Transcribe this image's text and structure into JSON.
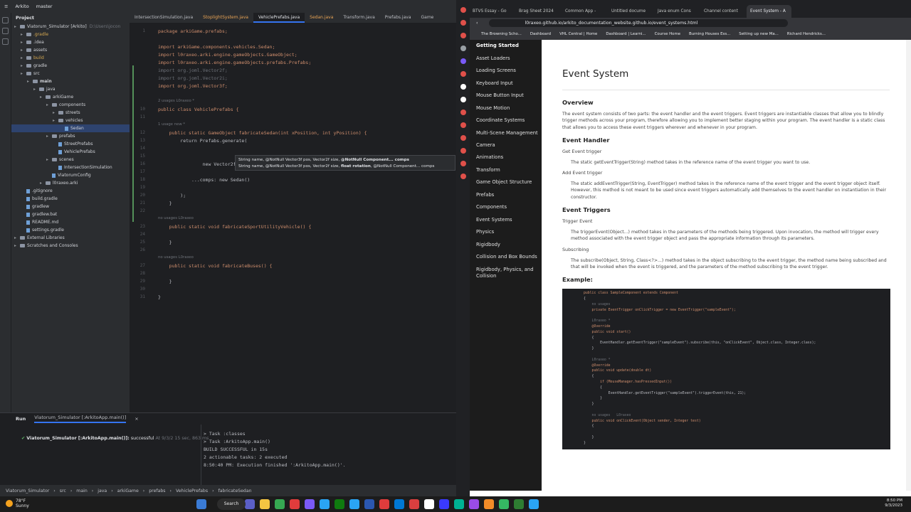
{
  "ide": {
    "menu_icon": "hamburger-icon",
    "project_name": "Arkito",
    "branch": "master",
    "panel_title": "Project",
    "tree": [
      {
        "label": "Viatorum_Simulator [Arkito]",
        "suffix": "D:\\Users\\jocon",
        "depth": 0,
        "kind": "folder",
        "state": ""
      },
      {
        "label": ".gradle",
        "suffix": "",
        "depth": 1,
        "kind": "folder",
        "state": "dim"
      },
      {
        "label": ".idea",
        "suffix": "",
        "depth": 1,
        "kind": "folder",
        "state": ""
      },
      {
        "label": "assets",
        "suffix": "",
        "depth": 1,
        "kind": "folder",
        "state": ""
      },
      {
        "label": "build",
        "suffix": "",
        "depth": 1,
        "kind": "folder",
        "state": "dim"
      },
      {
        "label": "gradle",
        "suffix": "",
        "depth": 1,
        "kind": "folder",
        "state": ""
      },
      {
        "label": "src",
        "suffix": "",
        "depth": 1,
        "kind": "folder",
        "state": ""
      },
      {
        "label": "main",
        "suffix": "",
        "depth": 2,
        "kind": "folder",
        "state": "bold"
      },
      {
        "label": "java",
        "suffix": "",
        "depth": 3,
        "kind": "folder",
        "state": ""
      },
      {
        "label": "arkiGame",
        "suffix": "",
        "depth": 4,
        "kind": "folder",
        "state": ""
      },
      {
        "label": "components",
        "suffix": "",
        "depth": 5,
        "kind": "folder",
        "state": ""
      },
      {
        "label": "streets",
        "suffix": "",
        "depth": 6,
        "kind": "folder",
        "state": ""
      },
      {
        "label": "vehicles",
        "suffix": "",
        "depth": 6,
        "kind": "folder",
        "state": ""
      },
      {
        "label": "Sedan",
        "suffix": "",
        "depth": 7,
        "kind": "file",
        "state": "sel"
      },
      {
        "label": "prefabs",
        "suffix": "",
        "depth": 5,
        "kind": "folder",
        "state": ""
      },
      {
        "label": "StreetPrefabs",
        "suffix": "",
        "depth": 6,
        "kind": "file",
        "state": ""
      },
      {
        "label": "VehiclePrefabs",
        "suffix": "",
        "depth": 6,
        "kind": "file",
        "state": ""
      },
      {
        "label": "scenes",
        "suffix": "",
        "depth": 5,
        "kind": "folder",
        "state": ""
      },
      {
        "label": "IntersectionSimulation",
        "suffix": "",
        "depth": 6,
        "kind": "file",
        "state": ""
      },
      {
        "label": "ViatorumConfig",
        "suffix": "",
        "depth": 5,
        "kind": "file",
        "state": ""
      },
      {
        "label": "l0raxeo.arki",
        "suffix": "",
        "depth": 4,
        "kind": "folder",
        "state": ""
      },
      {
        "label": ".gitignore",
        "suffix": "",
        "depth": 1,
        "kind": "file",
        "state": ""
      },
      {
        "label": "build.gradle",
        "suffix": "",
        "depth": 1,
        "kind": "file",
        "state": ""
      },
      {
        "label": "gradlew",
        "suffix": "",
        "depth": 1,
        "kind": "file",
        "state": ""
      },
      {
        "label": "gradlew.bat",
        "suffix": "",
        "depth": 1,
        "kind": "file",
        "state": ""
      },
      {
        "label": "README.md",
        "suffix": "",
        "depth": 1,
        "kind": "file",
        "state": ""
      },
      {
        "label": "settings.gradle",
        "suffix": "",
        "depth": 1,
        "kind": "file",
        "state": ""
      },
      {
        "label": "External Libraries",
        "suffix": "",
        "depth": 0,
        "kind": "folder",
        "state": ""
      },
      {
        "label": "Scratches and Consoles",
        "suffix": "",
        "depth": 0,
        "kind": "folder",
        "state": ""
      }
    ],
    "tabs": [
      {
        "label": "IntersectionSimulation.java",
        "state": ""
      },
      {
        "label": "StoplightSystem.java",
        "state": "orange"
      },
      {
        "label": "VehiclePrefabs.java",
        "state": "active"
      },
      {
        "label": "Sedan.java",
        "state": "orange"
      },
      {
        "label": "Transform.java",
        "state": ""
      },
      {
        "label": "Prefabs.java",
        "state": ""
      },
      {
        "label": "Game",
        "state": ""
      }
    ],
    "code": [
      {
        "n": "1",
        "t": "package arkiGame.prefabs;"
      },
      {
        "n": "",
        "t": ""
      },
      {
        "n": "",
        "t": "import arkiGame.components.vehicles.Sedan;"
      },
      {
        "n": "",
        "t": "import l0raxeo.arki.engine.gameObjects.GameObject;"
      },
      {
        "n": "",
        "t": "import l0raxeo.arki.engine.gameObjects.prefabs.Prefabs;"
      },
      {
        "n": "",
        "t": "import org.joml.Vector2f;"
      },
      {
        "n": "",
        "t": "import org.joml.Vector2i;"
      },
      {
        "n": "",
        "t": "import org.joml.Vector3f;"
      },
      {
        "n": "",
        "t": ""
      },
      {
        "n": "",
        "t": "2 usages   L0raxeo *"
      },
      {
        "n": "10",
        "t": "public class VehiclePrefabs {"
      },
      {
        "n": "11",
        "t": ""
      },
      {
        "n": "",
        "t": "    1 usage   new *"
      },
      {
        "n": "12",
        "t": "    public static GameObject fabricateSedan(int xPosition, int yPosition) {"
      },
      {
        "n": "13",
        "t": "        return Prefabs.generate("
      },
      {
        "n": "14",
        "t": ""
      },
      {
        "n": "15",
        "t": ""
      },
      {
        "n": "16",
        "t": "                new Vector2f( 0, 40);"
      },
      {
        "n": "17",
        "t": ""
      },
      {
        "n": "18",
        "t": "            ...comps: new Sedan()"
      },
      {
        "n": "19",
        "t": ""
      },
      {
        "n": "20",
        "t": "        );"
      },
      {
        "n": "21",
        "t": "    }"
      },
      {
        "n": "22",
        "t": ""
      },
      {
        "n": "",
        "t": "    no usages   L0raxeo"
      },
      {
        "n": "23",
        "t": "    public static void fabricateSportUtilityVehicle() {"
      },
      {
        "n": "24",
        "t": ""
      },
      {
        "n": "25",
        "t": "    }"
      },
      {
        "n": "26",
        "t": ""
      },
      {
        "n": "",
        "t": "    no usages   L0raxeo"
      },
      {
        "n": "27",
        "t": "    public static void fabricateBuses() {"
      },
      {
        "n": "28",
        "t": ""
      },
      {
        "n": "29",
        "t": "    }"
      },
      {
        "n": "30",
        "t": ""
      },
      {
        "n": "31",
        "t": "}"
      }
    ],
    "tooltip": {
      "line1_pre": "String name, @NotNull Vector3f pos, Vector2f size, ",
      "line1_bold": "@NotNull Component... comps",
      "line2_pre": "String name, @NotNull Vector3f pos, Vector2f size, ",
      "line2_bold": "float rotation",
      "line2_post": ", @NotNull Component... comps"
    },
    "run": {
      "label": "Run",
      "tab": "Viatorum_Simulator [:ArkitoApp.main()]",
      "tree_item": "Viatorum_Simulator [:ArkitoApp.main()]:",
      "tree_status": "successful",
      "tree_time": "At 9/3/2  15 sec, 863 ms",
      "output": [
        "> Task :classes",
        "> Task :ArkitoApp.main()",
        "",
        "BUILD SUCCESSFUL in 15s",
        "2 actionable tasks: 2 executed",
        "8:50:40 PM: Execution finished ':ArkitoApp.main()'."
      ]
    },
    "breadcrumbs": [
      "Viatorum_Simulator",
      "src",
      "main",
      "java",
      "arkiGame",
      "prefabs",
      "VehiclePrefabs",
      "fabricateSedan"
    ]
  },
  "browser": {
    "tabs": [
      {
        "label": "BTVS Essay - Go",
        "active": false
      },
      {
        "label": "Brag Sheet 2024",
        "active": false
      },
      {
        "label": "Common App -",
        "active": false
      },
      {
        "label": "Untitled docume",
        "active": false
      },
      {
        "label": "Java enum Cons",
        "active": false
      },
      {
        "label": "Channel content",
        "active": false
      },
      {
        "label": "Event System - A",
        "active": true
      }
    ],
    "url": "l0raxeo.github.io/arkito_documentation_website.github.io/event_systems.html",
    "bookmarks": [
      "The Browning Scho...",
      "Dashboard",
      "VHL Central | Home",
      "Dashboard | Learni...",
      "Course Home",
      "Burning Houses Ess...",
      "Setting up new Ma...",
      "Richard Hendricks..."
    ],
    "nav": [
      {
        "label": "Getting Started",
        "head": true
      },
      {
        "label": "Asset Loaders"
      },
      {
        "label": "Loading Screens"
      },
      {
        "label": "Keyboard Input"
      },
      {
        "label": "Mouse Button Input"
      },
      {
        "label": "Mouse Motion"
      },
      {
        "label": "Coordinate Systems"
      },
      {
        "label": "Multi-Scene Management",
        "two": true
      },
      {
        "label": "Camera"
      },
      {
        "label": "Animations"
      },
      {
        "label": "Transform"
      },
      {
        "label": "Game Object Structure"
      },
      {
        "label": "Prefabs"
      },
      {
        "label": "Components"
      },
      {
        "label": "Event Systems"
      },
      {
        "label": "Physics"
      },
      {
        "label": "Rigidbody"
      },
      {
        "label": "Collision and Box Bounds"
      },
      {
        "label": "Rigidbody, Physics, and Collision",
        "two": true
      }
    ],
    "page": {
      "title": "Event System",
      "overview_h": "Overview",
      "overview": "The event system consists of two parts: the event handler and the event triggers. Event triggers are instantiable classes that allow you to blindly trigger methods across your program, therefore allowing you to implement better staging within your program. The event handler is a static class that allows you to access these event triggers wherever and whenever in your program.",
      "handler_h": "Event Handler",
      "get_h": "Get Event trigger",
      "get_p": "The static getEventTrigger(String) method takes in the reference name of the event trigger you want to use.",
      "add_h": "Add Event trigger",
      "add_p": "The static addEventTrigger(String, EventTrigger) method takes in the reference name of the event trigger and the event trigger object itself. However, this method is not meant to be used since event triggers automatically add themselves to the event handler on instantiation in their constructor.",
      "triggers_h": "Event Triggers",
      "trigger_h": "Trigger Event",
      "trigger_p": "The triggerEvent(Object...) method takes in the parameters of the methods being triggered. Upon invocation, the method will trigger every method associated with the event trigger object and pass the appropriate information through its parameters.",
      "sub_h": "Subscribing",
      "sub_p": "The subscribe(Object, String, Class<?>...) method takes in the object subscribing to the event trigger, the method name being subscribed and that will be invoked when the event is triggered, and the parameters of the method subscribing to the event trigger.",
      "example_h": "Example:",
      "example_code": [
        "public class SampleComponent extends Component",
        "{",
        "    no usages",
        "    private EventTrigger onClickTrigger = new EventTrigger(\"sampleEvent\");",
        "",
        "    L0raxeo *",
        "    @Override",
        "    public void start()",
        "    {",
        "        EventHandler.getEventTrigger(\"sampleEvent\").subscribe(this, \"onClickEvent\", Object.class, Integer.class);",
        "    }",
        "",
        "    L0raxeo *",
        "    @Override",
        "    public void update(double dt)",
        "    {",
        "        if (MouseManager.hasPressedInput())",
        "        {",
        "            EventHandler.getEventTrigger(\"sampleEvent\").triggerEvent(this, 21);",
        "        }",
        "    }",
        "",
        "    no usages   L0raxeo",
        "    public void onClickEvent(Object sender, Integer test)",
        "    {",
        "",
        "    }",
        "}"
      ]
    }
  },
  "taskbar": {
    "temp": "78°F",
    "cond": "Sunny",
    "search": "Search",
    "time": "8:50 PM",
    "date": "9/3/2023"
  },
  "colors": {
    "accent": "#3574f0",
    "ide_bg": "#1e1f22",
    "panel_bg": "#2b2d30",
    "doc_nav_bg": "#1c1c1c",
    "task_colors": [
      "#3a7bd5",
      "#ffffff",
      "#5b5fc7",
      "#f4c542",
      "#36a852",
      "#e03c3c",
      "#7a5af8",
      "#2aa4f4",
      "#0f7b0f",
      "#2aa4f4",
      "#2b57b0",
      "#e03c3c",
      "#0078d4",
      "#d93f3f",
      "#ffffff",
      "#3a3aff",
      "#00b294",
      "#9a4ce6",
      "#f28c28",
      "#35b863",
      "#2e7d32",
      "#2aa4f4"
    ]
  }
}
